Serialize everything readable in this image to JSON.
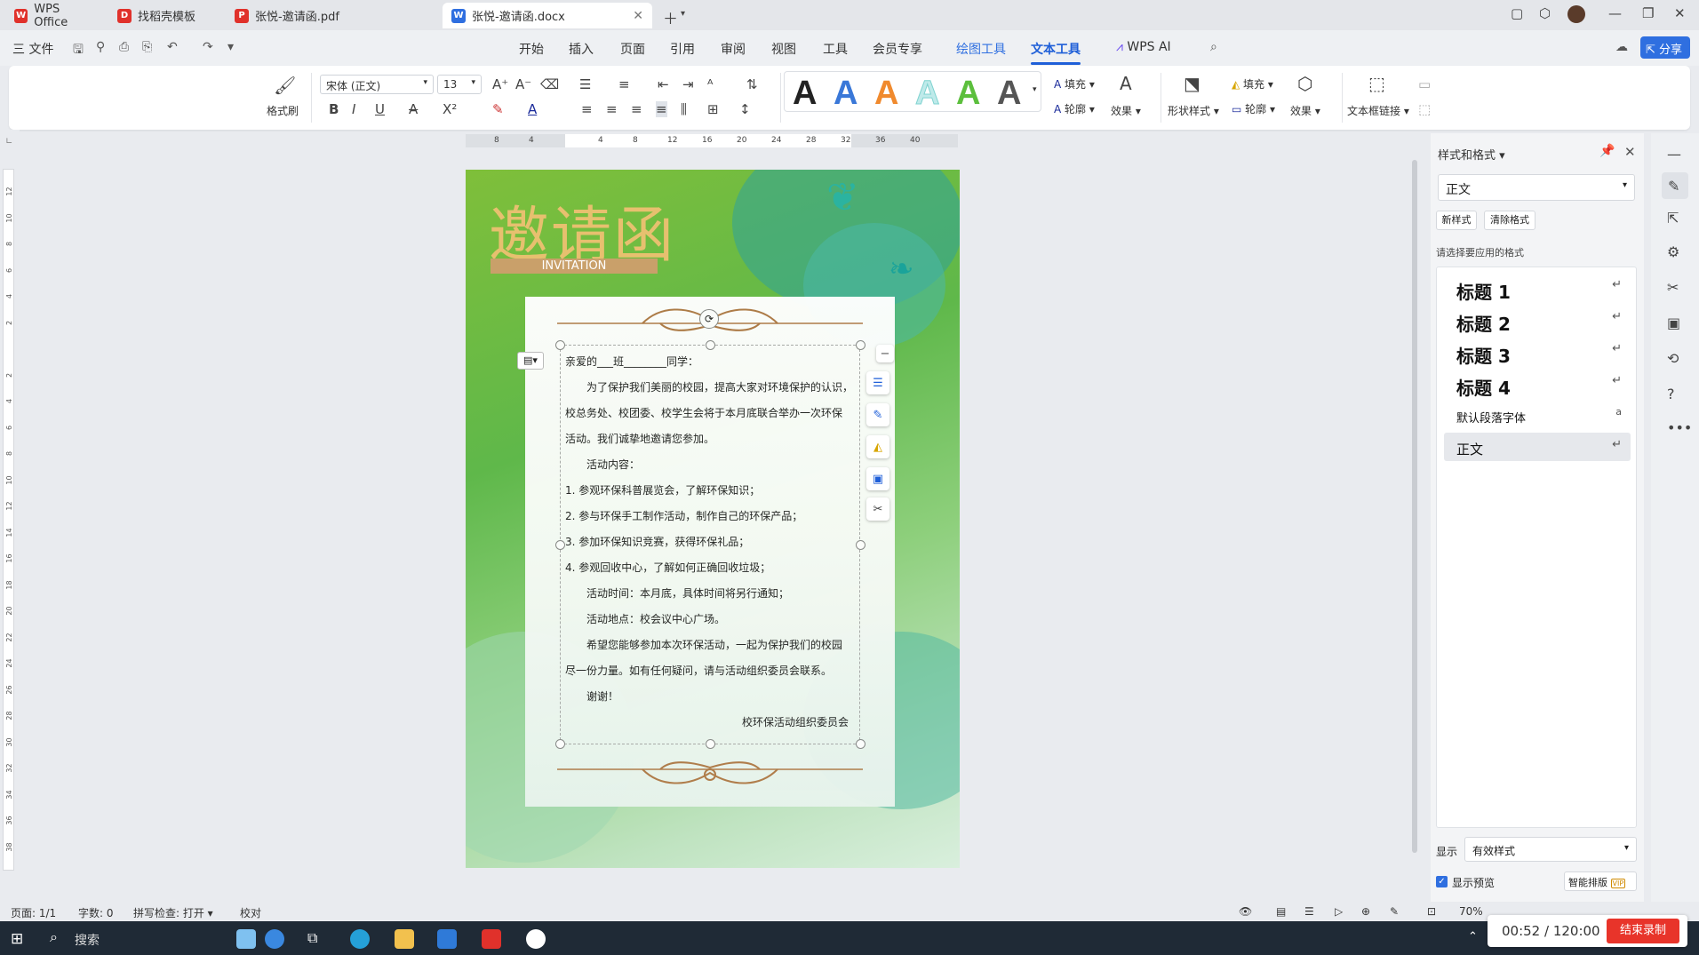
{
  "tabs": [
    {
      "label": "WPS Office",
      "icon": "wps-logo-icon",
      "color": "#e0312b"
    },
    {
      "label": "找稻壳模板",
      "icon": "docer-icon",
      "color": "#e0312b"
    },
    {
      "label": "张悦-邀请函.pdf",
      "icon": "pdf-icon",
      "color": "#e0312b"
    },
    {
      "label": "张悦-邀请函.docx",
      "icon": "word-icon",
      "color": "#2f6fe0"
    }
  ],
  "menu": {
    "file": "三 文件",
    "items": [
      "开始",
      "插入",
      "页面",
      "引用",
      "审阅",
      "视图",
      "工具",
      "会员专享",
      "绘图工具",
      "文本工具",
      "WPS AI"
    ],
    "share": "分享"
  },
  "ribbon": {
    "format_painter": "格式刷",
    "font_name": "宋体 (正文)",
    "font_size": "13",
    "fill": "填充",
    "outline": "轮廓",
    "effect": "效果",
    "shape_style": "形状样式",
    "fill2": "填充",
    "outline2": "轮廓",
    "effect2": "效果",
    "textbox_link": "文本框链接",
    "art_colors": [
      "#111111",
      "#3a78d8",
      "#f08a2e",
      "#7fd3d0",
      "#5cbf3d",
      "#555555"
    ]
  },
  "ruler": {
    "h": [
      "8",
      "4",
      "",
      "4",
      "8",
      "12",
      "16",
      "20",
      "24",
      "28",
      "32",
      "36",
      "40"
    ],
    "v": [
      "12",
      "10",
      "8",
      "6",
      "4",
      "2",
      "",
      "2",
      "4",
      "6",
      "8",
      "10",
      "12",
      "14",
      "16",
      "18",
      "20",
      "22",
      "24",
      "26",
      "28",
      "30",
      "32",
      "34",
      "36",
      "38"
    ]
  },
  "doc": {
    "title_cn": "邀请函",
    "title_en": "INVITATION",
    "lines": [
      "亲爱的___班________同学：",
      "为了保护我们美丽的校园，提高大家对环境保护的认识，",
      "校总务处、校团委、校学生会将于本月底联合举办一次环保",
      "活动。我们诚挚地邀请您参加。",
      "活动内容：",
      "1. 参观环保科普展览会，了解环保知识；",
      "2. 参与环保手工制作活动，制作自己的环保产品；",
      "3. 参加环保知识竞赛，获得环保礼品；",
      "4. 参观回收中心，了解如何正确回收垃圾；",
      "活动时间：本月底，具体时间将另行通知；",
      "活动地点：校会议中心广场。",
      "希望您能够参加本次环保活动，一起为保护我们的校园",
      "尽一份力量。如有任何疑问，请与活动组织委员会联系。",
      "谢谢！",
      "校环保活动组织委员会"
    ]
  },
  "panel": {
    "title": "样式和格式",
    "current": "正文",
    "new_style": "新样式",
    "clear_format": "清除格式",
    "hint": "请选择要应用的格式",
    "styles": [
      "标题 1",
      "标题 2",
      "标题 3",
      "标题 4"
    ],
    "default_font": "默认段落字体",
    "body": "正文",
    "show_label": "显示",
    "show_value": "有效样式",
    "preview_label": "显示预览",
    "smart_layout": "智能排版"
  },
  "status": {
    "page": "页面: 1/1",
    "words": "字数: 0",
    "spell": "拼写检查: 打开",
    "proof": "校对",
    "zoom": "70%"
  },
  "taskbar": {
    "search": "搜索"
  },
  "recording": {
    "time": "00:52 / 120:00",
    "stop": "结束录制"
  }
}
